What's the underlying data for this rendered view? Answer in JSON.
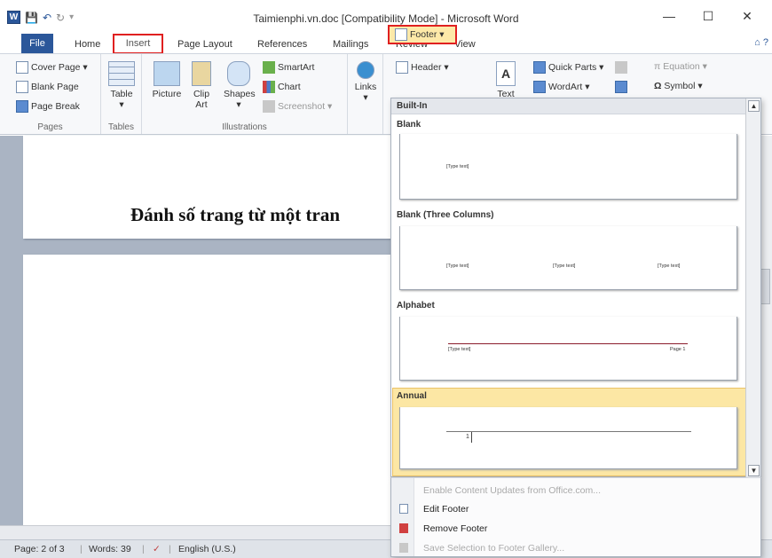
{
  "window": {
    "title": "Taimienphi.vn.doc [Compatibility Mode] - Microsoft Word",
    "minimize": "—",
    "maximize": "☐",
    "close": "✕"
  },
  "qat": {
    "app_icon": "W",
    "save": "💾",
    "undo": "↶",
    "redo": "↻",
    "customize": "▾"
  },
  "tabs": {
    "file": "File",
    "home": "Home",
    "insert": "Insert",
    "page_layout": "Page Layout",
    "references": "References",
    "mailings": "Mailings",
    "review": "Review",
    "view": "View",
    "help_icons": "⌂ ?"
  },
  "ribbon": {
    "pages": {
      "cover_page": "Cover Page ▾",
      "blank_page": "Blank Page",
      "page_break": "Page Break",
      "label": "Pages"
    },
    "tables": {
      "table": "Table",
      "table_arrow": "▾",
      "label": "Tables"
    },
    "illustrations": {
      "picture": "Picture",
      "clip_art_1": "Clip",
      "clip_art_2": "Art",
      "shapes": "Shapes",
      "shapes_arrow": "▾",
      "smartart": "SmartArt",
      "chart": "Chart",
      "screenshot": "Screenshot ▾",
      "label": "Illustrations"
    },
    "links": {
      "links": "Links",
      "arrow": "▾"
    },
    "header_footer": {
      "header": "Header ▾",
      "footer": "Footer ▾"
    },
    "text": {
      "text_box": "A",
      "text_label": "Text",
      "quick_parts": "Quick Parts ▾",
      "wordart": "WordArt ▾"
    },
    "symbols": {
      "equation": "Equation ▾",
      "symbol": "Symbol ▾"
    }
  },
  "document": {
    "heading": "Đánh số trang từ một tran"
  },
  "gallery": {
    "section": "Built-In",
    "items": [
      {
        "title": "Blank",
        "captions": [
          "[Type text]"
        ]
      },
      {
        "title": "Blank (Three Columns)",
        "captions": [
          "[Type text]",
          "[Type text]",
          "[Type text]"
        ]
      },
      {
        "title": "Alphabet",
        "captions": [
          "[Type text]",
          "Page 1"
        ]
      },
      {
        "title": "Annual",
        "captions": [
          "1"
        ]
      }
    ],
    "scroll_up": "▲",
    "scroll_down": "▼"
  },
  "menu": {
    "enable_updates": "Enable Content Updates from Office.com...",
    "edit_footer": "Edit Footer",
    "remove_footer": "Remove Footer",
    "save_selection": "Save Selection to Footer Gallery..."
  },
  "status": {
    "page": "Page: 2 of 3",
    "words": "Words: 39",
    "language": "English (U.S.)"
  },
  "colors": {
    "word_blue": "#2b579a",
    "highlight_red": "#e02020",
    "selected_item": "#fce7a4",
    "alphabet_rule": "#8b1c2c"
  }
}
